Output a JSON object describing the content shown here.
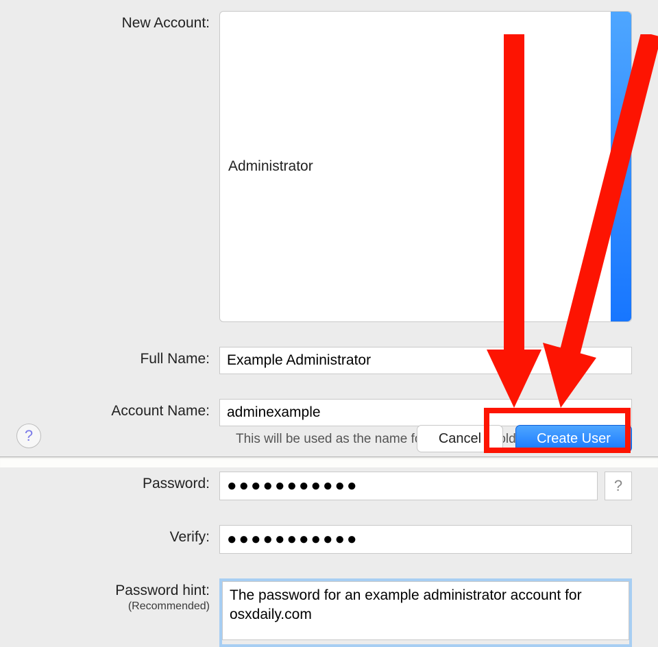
{
  "labels": {
    "new_account": "New Account:",
    "full_name": "Full Name:",
    "account_name": "Account Name:",
    "password": "Password:",
    "verify": "Verify:",
    "password_hint": "Password hint:",
    "recommended": "(Recommended)"
  },
  "values": {
    "new_account_selected": "Administrator",
    "full_name": "Example Administrator",
    "account_name": "adminexample",
    "password_masked": "●●●●●●●●●●●",
    "verify_masked": "●●●●●●●●●●●",
    "password_hint": "The password for an example administrator account for osxdaily.com"
  },
  "hints": {
    "account_name_helper": "This will be used as the name for your home folder."
  },
  "buttons": {
    "cancel": "Cancel",
    "create_user": "Create User",
    "password_assistant": "?",
    "help": "?"
  }
}
